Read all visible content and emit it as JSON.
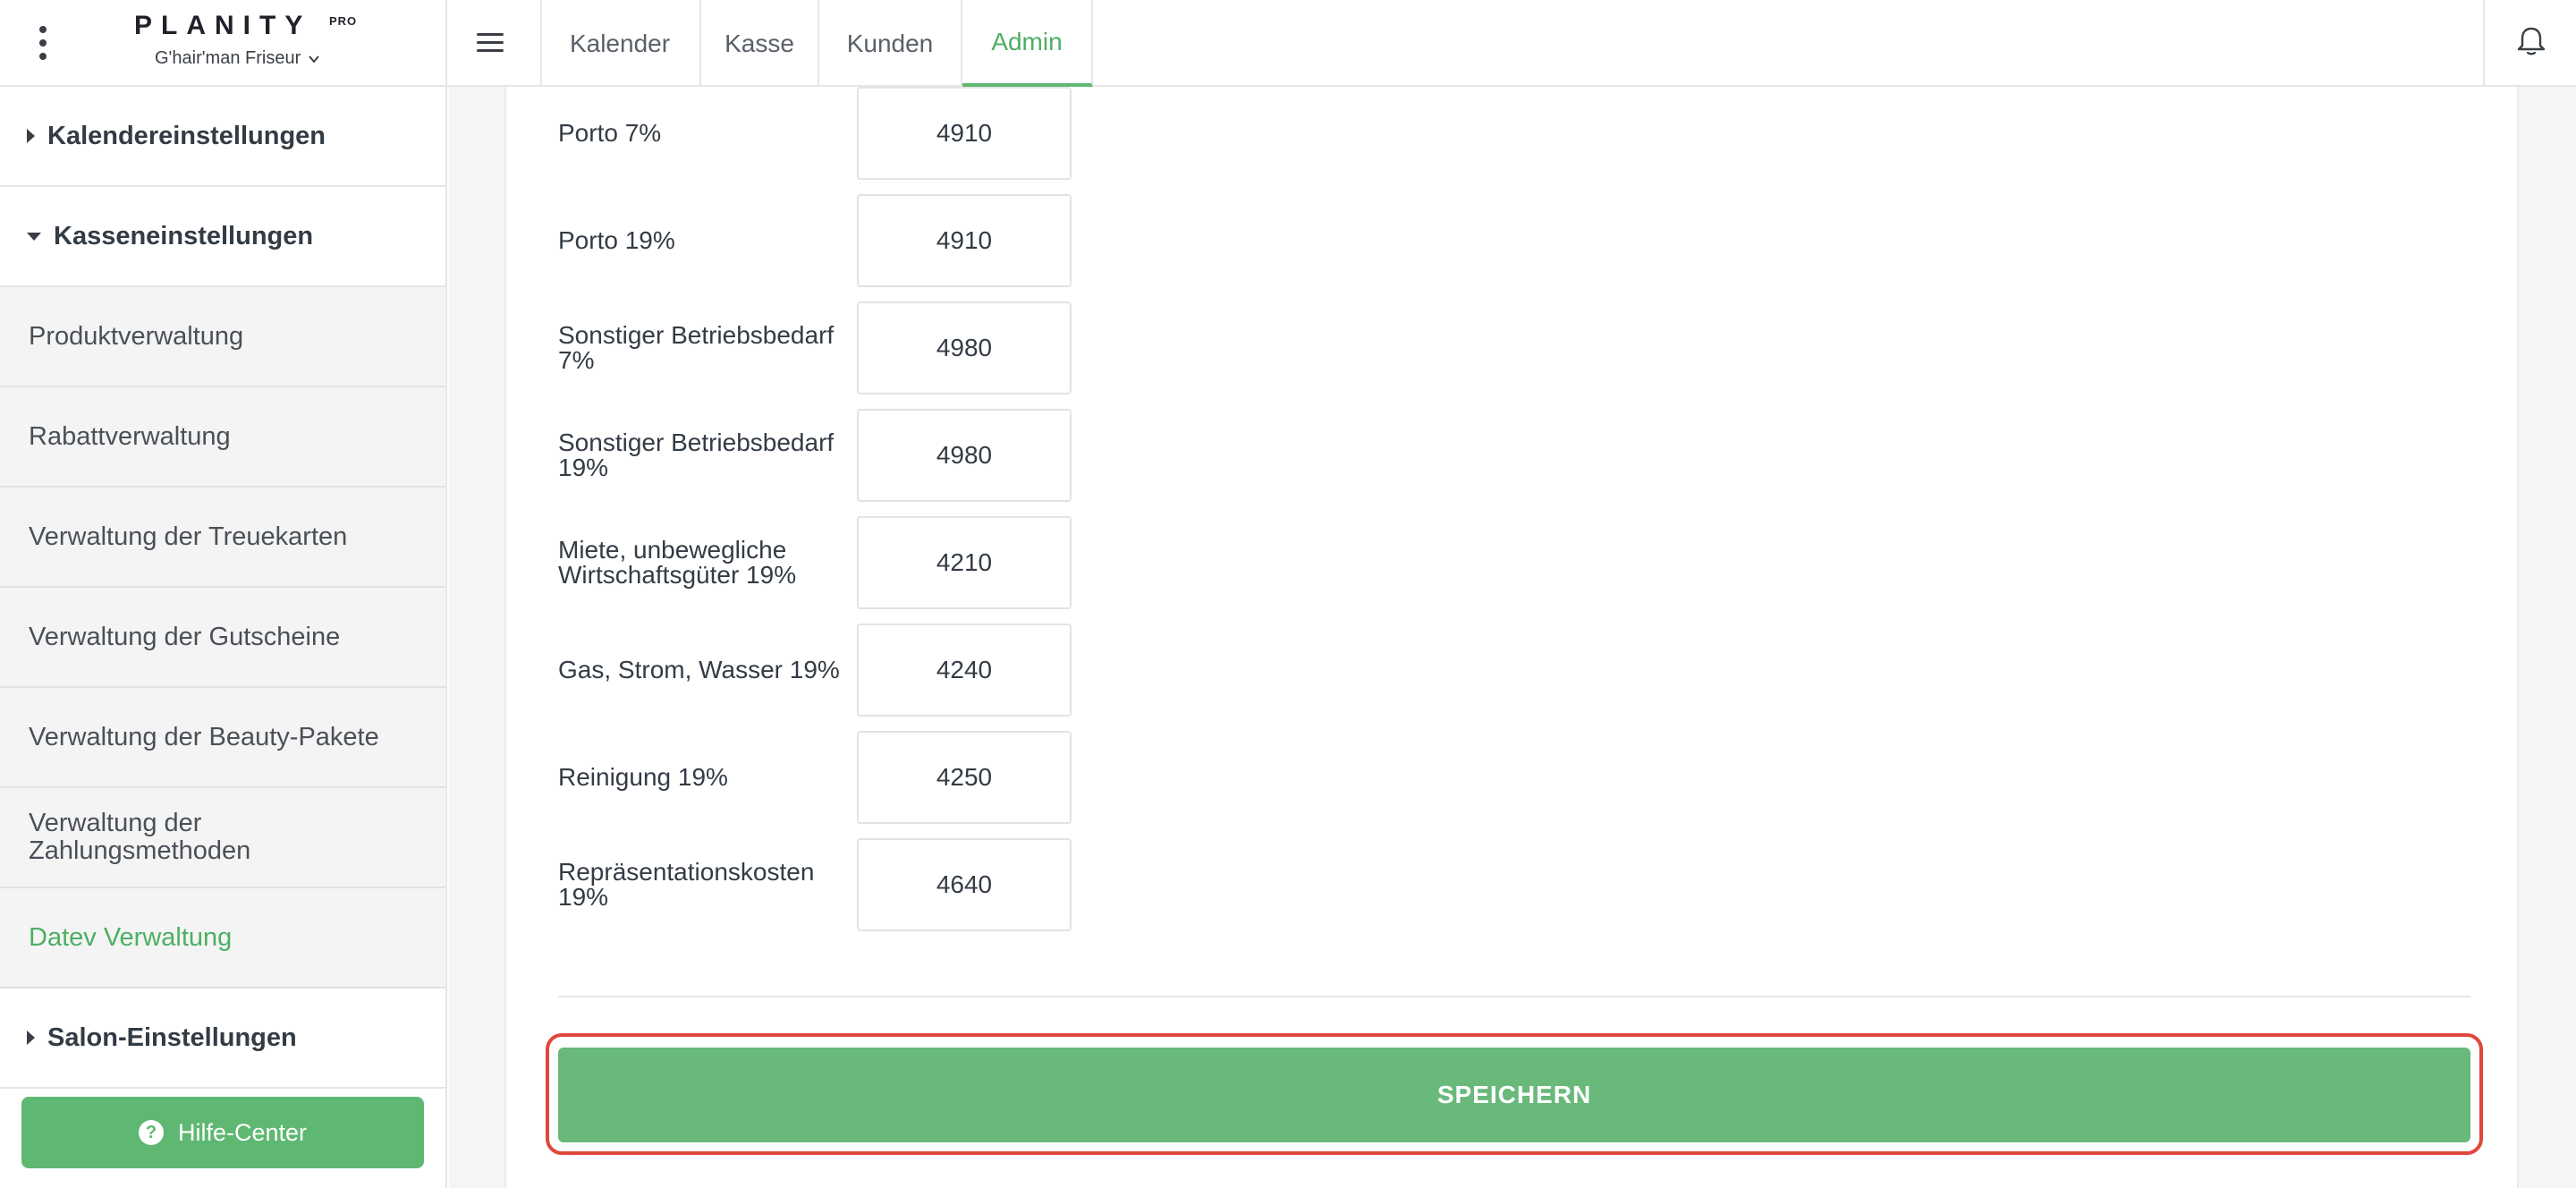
{
  "header": {
    "logo": "PLANITY",
    "logo_badge": "PRO",
    "salon_name": "G'hair'man Friseur",
    "tabs": [
      {
        "label": "Kalender"
      },
      {
        "label": "Kasse"
      },
      {
        "label": "Kunden"
      },
      {
        "label": "Admin",
        "active": true
      }
    ]
  },
  "sidebar": {
    "sections": {
      "calendar": "Kalendereinstellungen",
      "cash": "Kasseneinstellungen",
      "salon": "Salon-Einstellungen"
    },
    "items": [
      {
        "label": "Produktverwaltung"
      },
      {
        "label": "Rabattverwaltung"
      },
      {
        "label": "Verwaltung der Treuekarten"
      },
      {
        "label": "Verwaltung der Gutscheine"
      },
      {
        "label": "Verwaltung der Beauty-Pakete"
      },
      {
        "label": "Verwaltung der Zahlungsmethoden"
      },
      {
        "label": "Datev Verwaltung",
        "active": true
      }
    ],
    "help_label": "Hilfe-Center"
  },
  "form": {
    "rows": [
      {
        "label": "Porto 7%",
        "value": "4910"
      },
      {
        "label": "Porto 19%",
        "value": "4910"
      },
      {
        "label": "Sonstiger Betriebsbedarf 7%",
        "value": "4980"
      },
      {
        "label": "Sonstiger Betriebsbedarf 19%",
        "value": "4980"
      },
      {
        "label": "Miete, unbewegliche Wirtschaftsgüter 19%",
        "value": "4210"
      },
      {
        "label": "Gas, Strom, Wasser 19%",
        "value": "4240"
      },
      {
        "label": "Reinigung 19%",
        "value": "4250"
      },
      {
        "label": "Repräsentationskosten 19%",
        "value": "4640"
      }
    ],
    "save_label": "SPEICHERN"
  },
  "colors": {
    "accent": "#5fb872",
    "highlight": "#e0473c"
  }
}
